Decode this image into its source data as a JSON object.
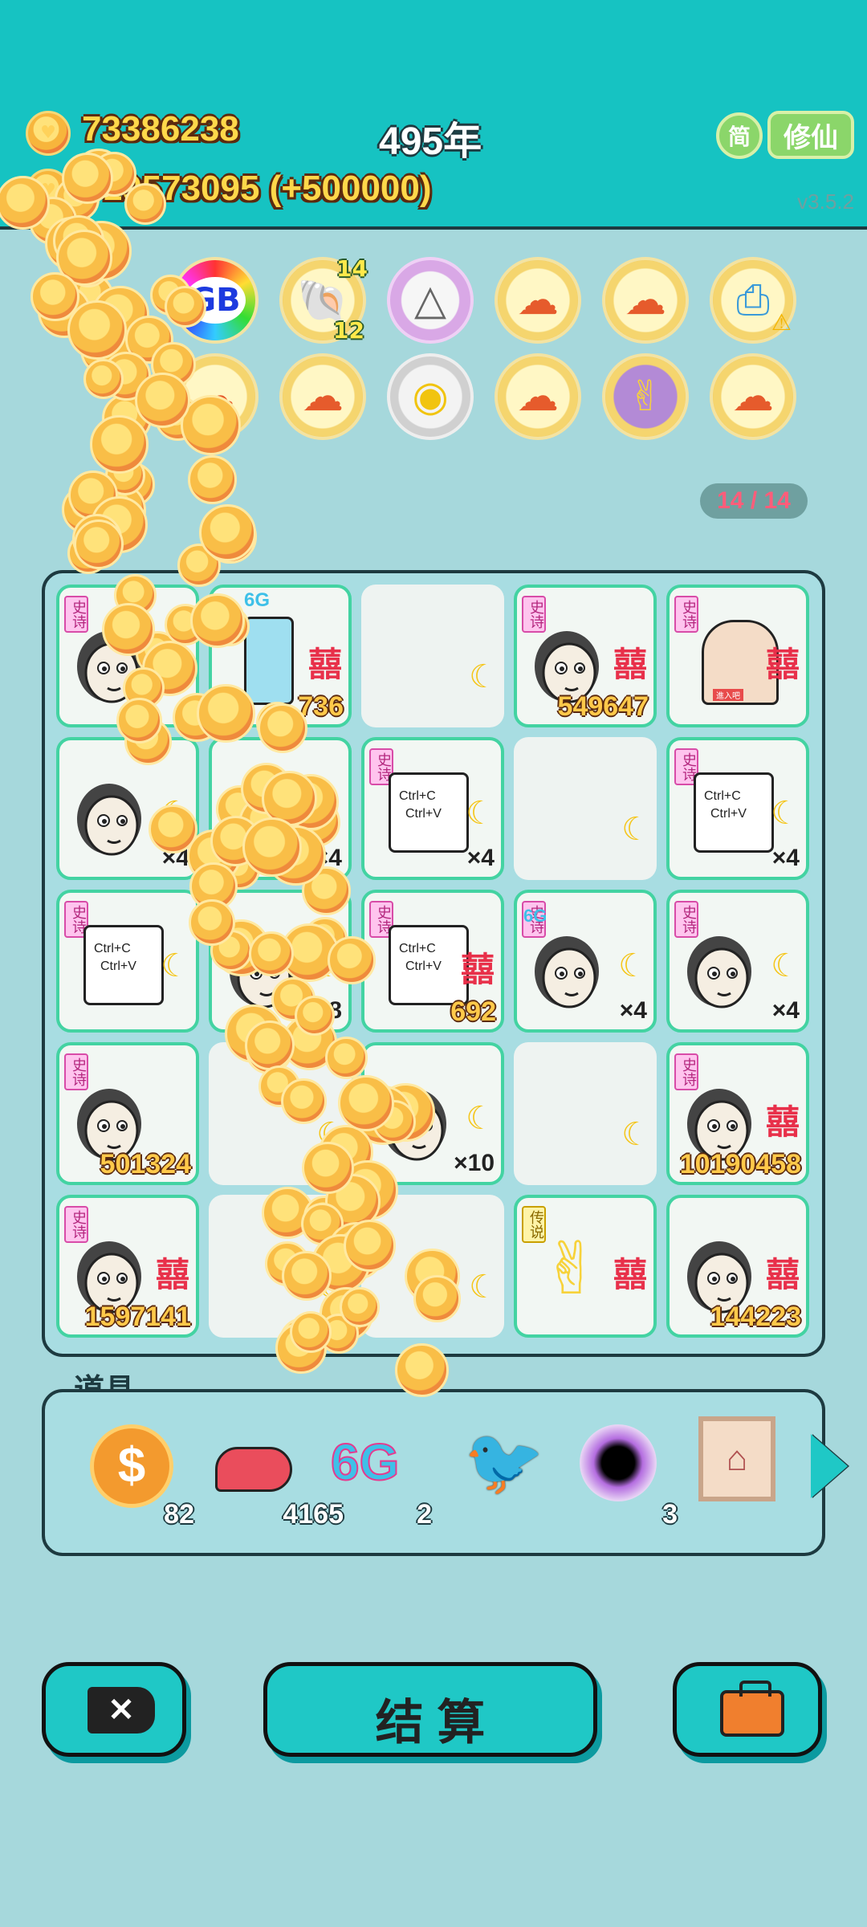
{
  "header": {
    "coins": "73386238",
    "year": "495年",
    "income": "+19573095 (+500000)",
    "lang_button": "简",
    "mode_button": "修仙",
    "version": "v3.5.2"
  },
  "relics": {
    "counter": "14 / 14",
    "items": [
      {
        "name": "rgb-relic",
        "label": "GB"
      },
      {
        "name": "shell-relic",
        "badge_top": "14",
        "badge_bottom": "12"
      },
      {
        "name": "skirt-relic"
      },
      {
        "name": "mushroom-cloud-relic"
      },
      {
        "name": "mushroom-cloud-relic"
      },
      {
        "name": "printer-relic"
      },
      {
        "name": "mushroom-cloud-relic"
      },
      {
        "name": "mushroom-cloud-relic"
      },
      {
        "name": "rice-cooker-relic"
      },
      {
        "name": "mushroom-cloud-relic"
      },
      {
        "name": "rock-hand-relic"
      },
      {
        "name": "mushroom-cloud-relic"
      }
    ]
  },
  "board": {
    "tag_epic": "史诗",
    "tag_legend": "传说",
    "xi": "囍",
    "copy_text_1": "Ctrl+C",
    "copy_text_2": "Ctrl+V",
    "badge_6g": "6G",
    "trap_label": "進入吧",
    "cells": [
      {
        "row": 0,
        "col": 0,
        "kind": "face",
        "tag": "epic",
        "xi": true
      },
      {
        "row": 0,
        "col": 1,
        "kind": "fridge",
        "value": "736",
        "xi": true
      },
      {
        "row": 0,
        "col": 2,
        "kind": "empty"
      },
      {
        "row": 0,
        "col": 3,
        "kind": "face",
        "tag": "epic",
        "xi": true,
        "value": "549647"
      },
      {
        "row": 0,
        "col": 4,
        "kind": "trap",
        "tag": "epic",
        "xi": true
      },
      {
        "row": 1,
        "col": 0,
        "kind": "face",
        "mult": "×4"
      },
      {
        "row": 1,
        "col": 1,
        "kind": "face",
        "mult": "×4"
      },
      {
        "row": 1,
        "col": 2,
        "kind": "copy",
        "tag": "epic",
        "mult": "×4"
      },
      {
        "row": 1,
        "col": 3,
        "kind": "empty"
      },
      {
        "row": 1,
        "col": 4,
        "kind": "copy",
        "tag": "epic",
        "mult": "×4"
      },
      {
        "row": 2,
        "col": 0,
        "kind": "copy",
        "tag": "epic"
      },
      {
        "row": 2,
        "col": 1,
        "kind": "face",
        "mult": "×8"
      },
      {
        "row": 2,
        "col": 2,
        "kind": "copy",
        "tag": "epic",
        "xi": true,
        "value": "692"
      },
      {
        "row": 2,
        "col": 3,
        "kind": "face",
        "tag": "epic",
        "mult": "×4",
        "g6": true
      },
      {
        "row": 2,
        "col": 4,
        "kind": "face",
        "tag": "epic",
        "mult": "×4"
      },
      {
        "row": 3,
        "col": 0,
        "kind": "face",
        "tag": "epic",
        "value": "501324"
      },
      {
        "row": 3,
        "col": 1,
        "kind": "empty"
      },
      {
        "row": 3,
        "col": 2,
        "kind": "face",
        "mult": "×10"
      },
      {
        "row": 3,
        "col": 3,
        "kind": "empty"
      },
      {
        "row": 3,
        "col": 4,
        "kind": "face",
        "tag": "epic",
        "xi": true,
        "value": "10190458"
      },
      {
        "row": 4,
        "col": 0,
        "kind": "face",
        "tag": "epic",
        "xi": true,
        "value": "1597141"
      },
      {
        "row": 4,
        "col": 1,
        "kind": "empty"
      },
      {
        "row": 4,
        "col": 2,
        "kind": "empty"
      },
      {
        "row": 4,
        "col": 3,
        "kind": "hand",
        "tag": "legend",
        "xi": true
      },
      {
        "row": 4,
        "col": 4,
        "kind": "face",
        "xi": true,
        "value": "144223"
      }
    ]
  },
  "props": {
    "title": "道具",
    "items": [
      {
        "name": "dollar-coin",
        "count": "82"
      },
      {
        "name": "liver",
        "count": "4165"
      },
      {
        "name": "6g",
        "label": "6G",
        "count": "2"
      },
      {
        "name": "pigeon",
        "count": ""
      },
      {
        "name": "black-hole",
        "count": "3"
      },
      {
        "name": "trap-frame",
        "count": ""
      }
    ]
  },
  "actions": {
    "settle_label": "结 算"
  },
  "colors": {
    "topbar": "#16c3c2",
    "background": "#a6d8dc",
    "coin_gold": "#ffd84a",
    "owned_border": "#43d3a2"
  }
}
